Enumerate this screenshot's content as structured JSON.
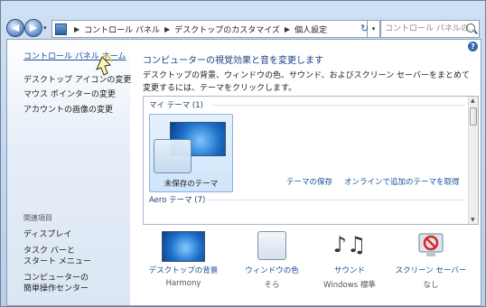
{
  "window": {
    "breadcrumbs": [
      "コントロール パネル",
      "デスクトップのカスタマイズ",
      "個人設定"
    ],
    "search_placeholder": "コントロール パネルの…"
  },
  "sidebar": {
    "home_link": "コントロール パネル ホーム",
    "tasks": [
      "デスクトップ アイコンの変更",
      "マウス ポインターの変更",
      "アカウントの画像の変更"
    ],
    "related_heading": "関連項目",
    "related": [
      {
        "line1": "ディスプレイ",
        "line2": ""
      },
      {
        "line1": "タスク バーと",
        "line2": "スタート メニュー"
      },
      {
        "line1": "コンピューターの",
        "line2": "簡単操作センター"
      }
    ]
  },
  "main": {
    "heading": "コンピューターの視覚効果と音を変更します",
    "description": "デスクトップの背景、ウィンドウの色、サウンド、およびスクリーン セーバーをまとめて変更するには、テーマをクリックします。",
    "my_themes_label": "マイ テーマ (1)",
    "unsaved_theme_label": "未保存のテーマ",
    "save_theme_link": "テーマの保存",
    "get_more_themes_link": "オンラインで追加のテーマを取得",
    "aero_themes_label": "Aero テーマ (7)"
  },
  "bottom": [
    {
      "label": "デスクトップの背景",
      "value": "Harmony",
      "icon": "desktop-background-icon"
    },
    {
      "label": "ウィンドウの色",
      "value": "そら",
      "icon": "window-color-icon"
    },
    {
      "label": "サウンド",
      "value": "Windows 標準",
      "icon": "sound-icon"
    },
    {
      "label": "スクリーン セーバー",
      "value": "なし",
      "icon": "screen-saver-icon"
    }
  ],
  "colors": {
    "link": "#1a4e9a",
    "heading": "#1a3f86",
    "frame": "#c9d9ec"
  }
}
